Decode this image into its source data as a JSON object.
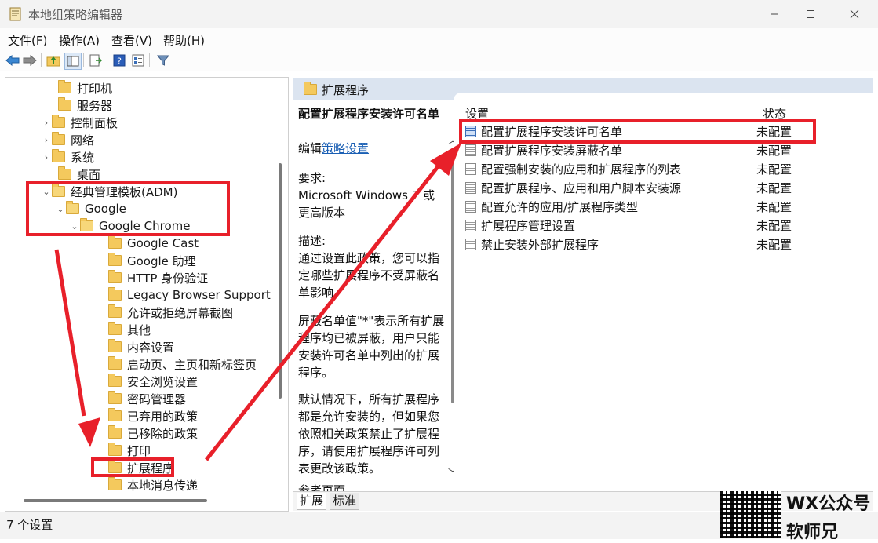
{
  "window": {
    "title": "本地组策略编辑器",
    "controls": [
      "minimize",
      "maximize",
      "close"
    ]
  },
  "menu": [
    "文件(F)",
    "操作(A)",
    "查看(V)",
    "帮助(H)"
  ],
  "toolbar_icons": [
    "back-arrow-icon",
    "forward-arrow-icon",
    "up-folder-icon",
    "show-tree-icon",
    "export-list-icon",
    "help-icon",
    "properties-icon",
    "filter-icon"
  ],
  "tree": [
    {
      "label": "打印机",
      "expander": ""
    },
    {
      "label": "服务器",
      "expander": ""
    },
    {
      "label": "控制面板",
      "expander": "›"
    },
    {
      "label": "网络",
      "expander": "›"
    },
    {
      "label": "系统",
      "expander": "›"
    },
    {
      "label": "桌面",
      "expander": ""
    },
    {
      "label": "经典管理模板(ADM)",
      "expander": "⌄"
    },
    {
      "label": "Google",
      "expander": "⌄"
    },
    {
      "label": "Google Chrome",
      "expander": "⌄"
    },
    {
      "label": "Google Cast",
      "expander": ""
    },
    {
      "label": "Google 助理",
      "expander": ""
    },
    {
      "label": "HTTP 身份验证",
      "expander": ""
    },
    {
      "label": "Legacy Browser Support",
      "expander": ""
    },
    {
      "label": "允许或拒绝屏幕截图",
      "expander": ""
    },
    {
      "label": "其他",
      "expander": ""
    },
    {
      "label": "内容设置",
      "expander": ""
    },
    {
      "label": "启动页、主页和新标签页",
      "expander": ""
    },
    {
      "label": "安全浏览设置",
      "expander": ""
    },
    {
      "label": "密码管理器",
      "expander": ""
    },
    {
      "label": "已弃用的政策",
      "expander": ""
    },
    {
      "label": "已移除的政策",
      "expander": ""
    },
    {
      "label": "打印",
      "expander": ""
    },
    {
      "label": "扩展程序",
      "expander": ""
    },
    {
      "label": "本地消息传递",
      "expander": ""
    }
  ],
  "right_header": "扩展程序",
  "description": {
    "title": "配置扩展程序安装许可名单",
    "edit_prefix": "编辑",
    "edit_link": "策略设置",
    "requirements_label": "要求:",
    "requirements_text": "Microsoft Windows 7 或更高版本",
    "description_label": "描述:",
    "para1": "通过设置此政策，您可以指定哪些扩展程序不受屏蔽名单影响。",
    "para2": "屏蔽名单值\"*\"表示所有扩展程序均已被屏蔽，用户只能安装许可名单中列出的扩展程序。",
    "para3": "默认情况下，所有扩展程序都是允许安装的，但如果您依照相关政策禁止了扩展程序，请使用扩展程序许可列表更改该政策。",
    "para4": "参考页面"
  },
  "list": {
    "columns": [
      "设置",
      "状态"
    ],
    "rows": [
      {
        "setting": "配置扩展程序安装许可名单",
        "state": "未配置"
      },
      {
        "setting": "配置扩展程序安装屏蔽名单",
        "state": "未配置"
      },
      {
        "setting": "配置强制安装的应用和扩展程序的列表",
        "state": "未配置"
      },
      {
        "setting": "配置扩展程序、应用和用户脚本安装源",
        "state": "未配置"
      },
      {
        "setting": "配置允许的应用/扩展程序类型",
        "state": "未配置"
      },
      {
        "setting": "扩展程序管理设置",
        "state": "未配置"
      },
      {
        "setting": "禁止安装外部扩展程序",
        "state": "未配置"
      }
    ]
  },
  "tabs": [
    "扩展",
    "标准"
  ],
  "status": "7 个设置",
  "watermark": {
    "line1": "WX公众号",
    "line2": "软师兄"
  },
  "colors": {
    "annotation_red": "#e8202a",
    "header_bg": "#dbe4f0",
    "folder": "#f4c95d"
  }
}
